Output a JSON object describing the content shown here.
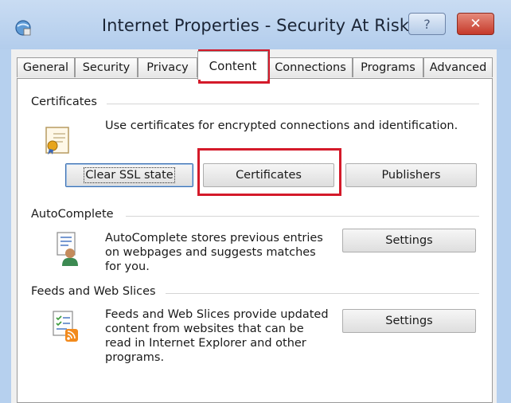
{
  "window": {
    "title": "Internet Properties - Security At Risk",
    "help_glyph": "?",
    "close_glyph": "✕"
  },
  "tabs": [
    {
      "label": "General"
    },
    {
      "label": "Security"
    },
    {
      "label": "Privacy"
    },
    {
      "label": "Content",
      "active": true
    },
    {
      "label": "Connections"
    },
    {
      "label": "Programs"
    },
    {
      "label": "Advanced"
    }
  ],
  "certificates": {
    "title": "Certificates",
    "description": "Use certificates for encrypted connections and identification.",
    "clear_ssl_button": "Clear SSL state",
    "certificates_button": "Certificates",
    "publishers_button": "Publishers",
    "icon": "certificate-icon"
  },
  "autocomplete": {
    "title": "AutoComplete",
    "description_line1": "AutoComplete stores previous entries",
    "description_line2": "on webpages and suggests matches",
    "description_line3": "for you.",
    "settings_button": "Settings",
    "icon": "autocomplete-icon"
  },
  "feeds": {
    "title": "Feeds and Web Slices",
    "description_line1": "Feeds and Web Slices provide updated",
    "description_line2": "content from websites that can be",
    "description_line3": "read in Internet Explorer and other",
    "description_line4": "programs.",
    "settings_button": "Settings",
    "icon": "feeds-icon"
  },
  "colors": {
    "highlight": "#d41a2a",
    "title_bar": "#b6d0ee",
    "close_button": "#c5392a"
  }
}
